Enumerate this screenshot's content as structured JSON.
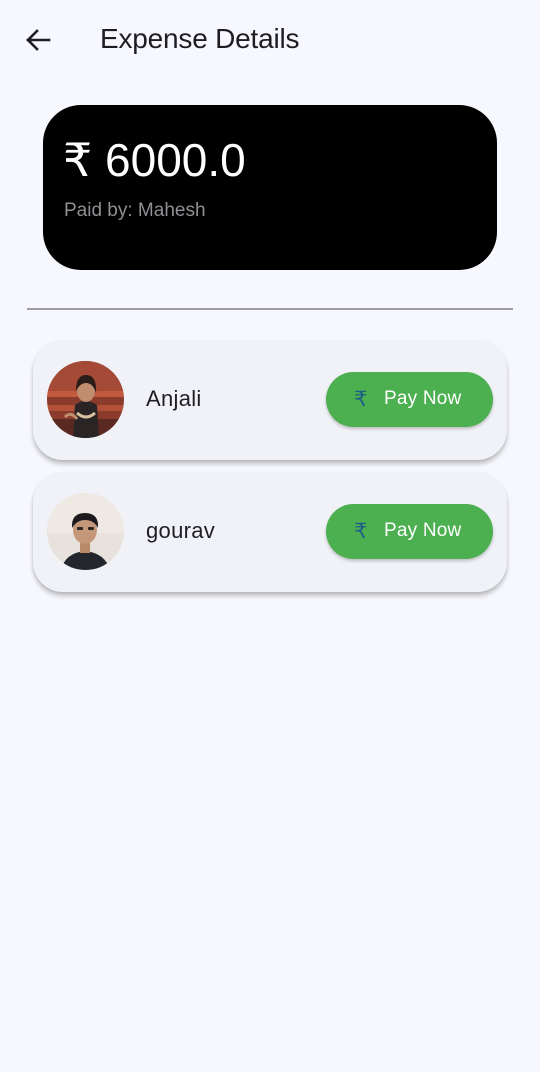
{
  "header": {
    "back_icon": "arrow-left-icon",
    "title": "Expense Details"
  },
  "summary": {
    "amount": "₹ 6000.0",
    "paid_by": "Paid by: Mahesh"
  },
  "members": [
    {
      "name": "Anjali",
      "avatar": "user-photo",
      "button": {
        "icon": "rupee-icon",
        "icon_glyph": "₹",
        "label": "Pay Now"
      }
    },
    {
      "name": "gourav",
      "avatar": "user-photo",
      "button": {
        "icon": "rupee-icon",
        "icon_glyph": "₹",
        "label": "Pay Now"
      }
    }
  ],
  "colors": {
    "background": "#f7f8fd",
    "card": "#000000",
    "pay_button": "#4caf50",
    "rupee_icon": "#1f5e86"
  }
}
